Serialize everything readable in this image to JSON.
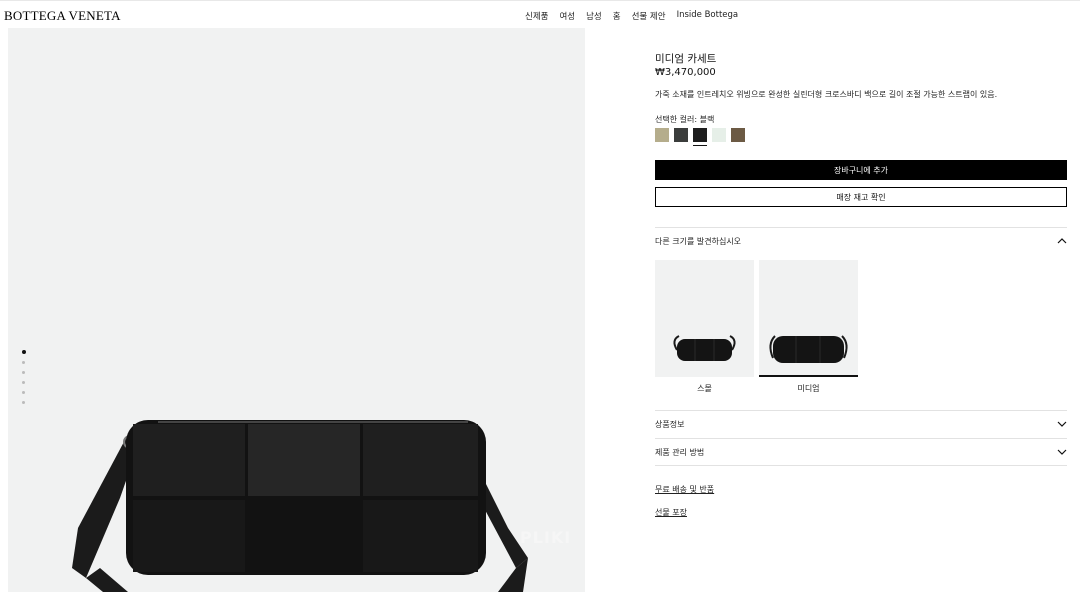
{
  "header": {
    "logo": "BOTTEGA VENETA",
    "nav": [
      "신제품",
      "여성",
      "남성",
      "홈",
      "선물 제안",
      "Inside Bottega"
    ]
  },
  "gallery": {
    "watermark": "PLIKI",
    "dots_total": 6,
    "dots_active": 1
  },
  "product": {
    "title": "미디엄 카세트",
    "price": "₩3,470,000",
    "description": "가죽 소재를 인트레치오 위빙으로 완성한 실린더형 크로스바디 백으로 길이 조절 가능한 스트랩이 있음.",
    "color_label": "선택한 컬러: 블랙",
    "swatches": [
      {
        "name": "sand",
        "color": "#b5ad8c"
      },
      {
        "name": "charcoal",
        "color": "#3b3d3c"
      },
      {
        "name": "black",
        "color": "#1e1e1e"
      },
      {
        "name": "mint",
        "color": "#e6efe8"
      },
      {
        "name": "brown",
        "color": "#6c5a44"
      }
    ],
    "selected_swatch": 2
  },
  "actions": {
    "add_to_cart": "장바구니에 추가",
    "check_stock": "매장 재고 확인"
  },
  "sizes_section": {
    "title": "다른 크기를 발견하십시오",
    "sizes": [
      {
        "label": "스몰"
      },
      {
        "label": "미디엄"
      }
    ],
    "selected": 1
  },
  "accordions": {
    "product_info": "상품정보",
    "care": "제품 관리 방법"
  },
  "links": {
    "shipping": "무료 배송 및 반품",
    "gift_wrap": "선물 포장"
  },
  "colors": {
    "accent": "#000000",
    "background": "#f1f2f2"
  }
}
